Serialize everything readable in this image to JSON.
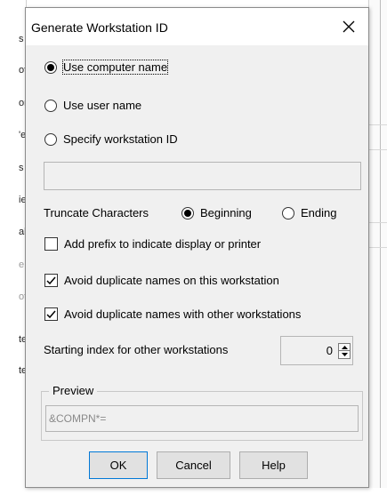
{
  "background": {
    "left_edge_letters": [
      "s",
      "ot",
      "or",
      "'e",
      "s",
      "ie",
      "al",
      "e",
      "ot",
      "te",
      "te"
    ]
  },
  "dialog": {
    "title": "Generate Workstation ID",
    "close_icon": "close-icon",
    "options": {
      "computer_name": {
        "label": "Use computer name",
        "selected": true
      },
      "user_name": {
        "label": "Use user name",
        "selected": false
      },
      "specify_id": {
        "label": "Specify workstation ID",
        "selected": false
      }
    },
    "workstation_id_value": "",
    "truncate": {
      "label": "Truncate Characters",
      "beginning": {
        "label": "Beginning",
        "selected": true
      },
      "ending": {
        "label": "Ending",
        "selected": false
      }
    },
    "checkboxes": {
      "add_prefix": {
        "label": "Add prefix to indicate display or printer",
        "checked": false
      },
      "avoid_dup_this": {
        "label": "Avoid duplicate names on this workstation",
        "checked": true
      },
      "avoid_dup_other": {
        "label": "Avoid duplicate names with other workstations",
        "checked": true
      }
    },
    "starting_index": {
      "label": "Starting index for other workstations",
      "value": "0"
    },
    "preview": {
      "group_label": "Preview",
      "value": "&COMPN*="
    },
    "buttons": {
      "ok": "OK",
      "cancel": "Cancel",
      "help": "Help"
    }
  }
}
